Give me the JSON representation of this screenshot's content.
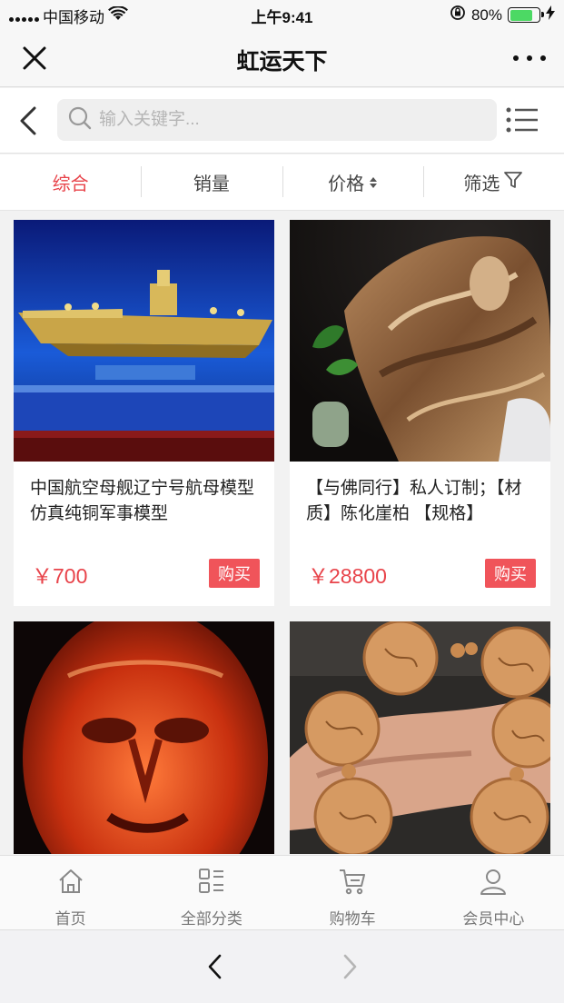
{
  "status_bar": {
    "carrier": "中国移动",
    "time": "上午9:41",
    "battery_percent": "80%",
    "battery_level": 0.8
  },
  "nav": {
    "title": "虹运天下",
    "close_icon": "close-icon",
    "more_icon": "more-icon"
  },
  "search": {
    "placeholder": "输入关键字...",
    "value": ""
  },
  "filters": [
    {
      "label": "综合",
      "active": true
    },
    {
      "label": "销量",
      "active": false
    },
    {
      "label": "价格",
      "active": false
    },
    {
      "label": "筛选",
      "active": false
    }
  ],
  "products": [
    {
      "title": "中国航空母舰辽宁号航母模型 仿真纯铜军事模型",
      "price": "￥700",
      "buy_label": "购买",
      "image": "aircraft-carrier-model"
    },
    {
      "title": "【与佛同行】私人订制；【材质】陈化崖柏 【规格】",
      "price": "￥28800",
      "buy_label": "购买",
      "image": "cliff-cypress-buddha-carving"
    },
    {
      "title": "",
      "price": "",
      "buy_label": "",
      "image": "red-agate-face-carving"
    },
    {
      "title": "",
      "price": "",
      "buy_label": "",
      "image": "carved-olive-pit-bracelet"
    }
  ],
  "tabbar": [
    {
      "label": "首页",
      "icon": "home-icon"
    },
    {
      "label": "全部分类",
      "icon": "category-icon"
    },
    {
      "label": "购物车",
      "icon": "cart-icon"
    },
    {
      "label": "会员中心",
      "icon": "user-icon"
    }
  ],
  "colors": {
    "accent": "#e8434a",
    "buy_button": "#f0545a",
    "battery": "#4cd964"
  }
}
